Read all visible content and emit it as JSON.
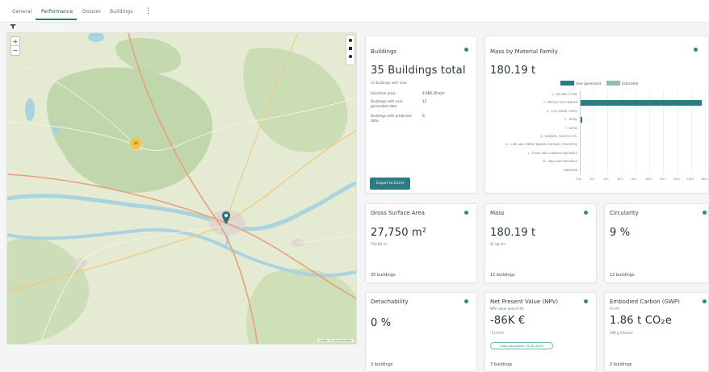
{
  "tabs": [
    {
      "label": "General"
    },
    {
      "label": "Performance",
      "active": true
    },
    {
      "label": "Dossier"
    },
    {
      "label": "Buildings"
    }
  ],
  "kebab": "⋮",
  "map": {
    "zoom_in": "+",
    "zoom_out": "−",
    "cluster_count": "30",
    "attribution": "Leaflet | © OpenStreetMap"
  },
  "cards": {
    "buildings": {
      "title": "Buildings",
      "total": "35 Buildings total",
      "subtitle": "12 Buildings with data",
      "selection_area_label": "Selection area:",
      "selection_area_value": "9,385.29 km²",
      "user_data_label": "Buildings with user generated data",
      "user_data_value": "12",
      "predicted_label": "Buildings with predicted data",
      "predicted_value": "0",
      "export_label": "Export to Excel"
    },
    "mass_family": {
      "title": "Mass by Material Family",
      "value": "180.19 t"
    },
    "gross_area": {
      "title": "Gross Surface Area",
      "value": "27,750 m²",
      "sub": "793.86 m²",
      "foot": "35 buildings"
    },
    "mass": {
      "title": "Mass",
      "value": "180.19 t",
      "sub": "21 kg /m²",
      "foot": "12 buildings"
    },
    "circularity": {
      "title": "Circularity",
      "value": "9 %",
      "foot": "12 buildings"
    },
    "detachability": {
      "title": "Detachability",
      "value": "0 %",
      "foot": "3 buildings"
    },
    "npv": {
      "title": "Net Present Value (NPV)",
      "desc": "NPV value end of life",
      "value": "-86K €",
      "sub": "-13 €/m²",
      "badge": "Last calculated: 15-02-2023",
      "foot": "3 buildings"
    },
    "carbon": {
      "title": "Embodied Carbon (GWP)",
      "desc": "A1-A3",
      "value": "1.86 t CO₂e",
      "sub": "298 g CO₂e/m²",
      "foot": "2 buildings"
    }
  },
  "colors": {
    "accent": "#2f7b84",
    "status_dot": "#2f8a7d",
    "user_generated": "#2f7b84",
    "estimated": "#8ec0b7"
  },
  "chart_data": {
    "type": "bar",
    "orientation": "horizontal",
    "title": "Mass by Material Family",
    "legend": [
      "User generated",
      "Estimated"
    ],
    "legend_position": "top",
    "categories": [
      "2 - NATURAL STONE",
      "3 - PRECAST WITH BINDER",
      "6 - CLAY (DRIED, FIRED)",
      "5 - METAL",
      "7 - WOOD",
      "8 - RUBBERS, PLASTICS ETC.",
      "12 - LIME AND CEMENT BINDER, MORTARS, CONCRETES",
      "1 - FOAMS AND LOWERING MATERIALS",
      "18 - ANCILLARY MATERIALS",
      "UNKNOWN"
    ],
    "series": [
      {
        "name": "User generated",
        "values": [
          0.5,
          175.0,
          0.3,
          3.0,
          0.8,
          0.2,
          0.2,
          0.1,
          0.2,
          0.1
        ]
      },
      {
        "name": "Estimated",
        "values": [
          0,
          0,
          0,
          0,
          0,
          0,
          0,
          0,
          0,
          0
        ]
      }
    ],
    "x_ticks": [
      "0 kg",
      "20 t",
      "40 t",
      "60 t",
      "80 t",
      "100 t",
      "120 t",
      "140 t",
      "160 t",
      "180 t"
    ],
    "xlim": [
      0,
      180
    ],
    "grid": true
  }
}
